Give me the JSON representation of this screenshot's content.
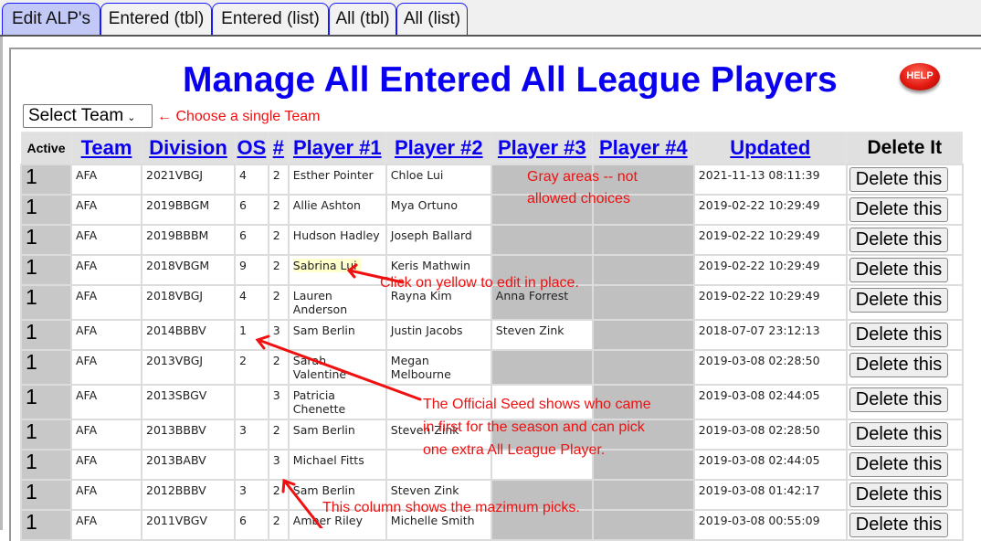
{
  "tabs": [
    {
      "label": "Edit ALP's",
      "active": true
    },
    {
      "label": "Entered (tbl)",
      "active": false
    },
    {
      "label": "Entered (list)",
      "active": false
    },
    {
      "label": "All (tbl)",
      "active": false
    },
    {
      "label": "All (list)",
      "active": false
    }
  ],
  "page": {
    "title": "Manage All Entered All League Players",
    "help_label": "HELP",
    "team_select": {
      "value": "Select Team",
      "chevron": "⌄"
    }
  },
  "annotations": {
    "choose_team": "← Choose a single Team",
    "gray_areas_1": "Gray areas -- not",
    "gray_areas_2": "allowed choices",
    "click_yellow": "Click on yellow to edit in place.",
    "official_seed_1": "The Official Seed shows who came",
    "official_seed_2": "in first for the season and can pick",
    "official_seed_3": "one extra All League Player.",
    "max_picks": "This column shows the mazimum picks.",
    "color": "#f01010"
  },
  "table": {
    "headers": {
      "active": "Active",
      "team": "Team",
      "division": "Division",
      "os": "OS",
      "num": "#",
      "p1": "Player #1",
      "p2": "Player #2",
      "p3": "Player #3",
      "p4": "Player #4",
      "updated": "Updated",
      "delete": "Delete It"
    },
    "delete_label": "Delete this",
    "rows": [
      {
        "active": "1",
        "team": "AFA",
        "division": "2021VBGJ",
        "os": "4",
        "num": "2",
        "p1": "Esther Pointer",
        "p2": "Chloe Lui",
        "p3": "",
        "p4": "",
        "updated": "2021-11-13 08:11:39"
      },
      {
        "active": "1",
        "team": "AFA",
        "division": "2019BBGM",
        "os": "6",
        "num": "2",
        "p1": "Allie Ashton",
        "p2": "Mya Ortuno",
        "p3": "",
        "p4": "",
        "updated": "2019-02-22 10:29:49"
      },
      {
        "active": "1",
        "team": "AFA",
        "division": "2019BBBM",
        "os": "6",
        "num": "2",
        "p1": "Hudson Hadley",
        "p2": "Joseph Ballard",
        "p3": "",
        "p4": "",
        "updated": "2019-02-22 10:29:49"
      },
      {
        "active": "1",
        "team": "AFA",
        "division": "2018VBGM",
        "os": "9",
        "num": "2",
        "p1": "Sabrina Lui",
        "p2": "Keris Mathwin",
        "p3": "",
        "p4": "",
        "updated": "2019-02-22 10:29:49",
        "highlight_p1": true
      },
      {
        "active": "1",
        "team": "AFA",
        "division": "2018VBGJ",
        "os": "4",
        "num": "2",
        "p1": "Lauren Anderson",
        "p2": "Rayna Kim",
        "p3": "Anna Forrest",
        "p4": "",
        "updated": "2019-02-22 10:29:49"
      },
      {
        "active": "1",
        "team": "AFA",
        "division": "2014BBBV",
        "os": "1",
        "num": "3",
        "p1": "Sam Berlin",
        "p2": "Justin Jacobs",
        "p3": "Steven Zink",
        "p4": "",
        "updated": "2018-07-07 23:12:13"
      },
      {
        "active": "1",
        "team": "AFA",
        "division": "2013VBGJ",
        "os": "2",
        "num": "2",
        "p1": "Sarah Valentine",
        "p2": "Megan Melbourne",
        "p3": "",
        "p4": "",
        "updated": "2019-03-08 02:28:50"
      },
      {
        "active": "1",
        "team": "AFA",
        "division": "2013SBGV",
        "os": "",
        "num": "3",
        "p1": "Patricia Chenette",
        "p2": "",
        "p3": "",
        "p4": "",
        "updated": "2019-03-08 02:44:05"
      },
      {
        "active": "1",
        "team": "AFA",
        "division": "2013BBBV",
        "os": "3",
        "num": "2",
        "p1": "Sam Berlin",
        "p2": "Steven Zink",
        "p3": "",
        "p4": "",
        "updated": "2019-03-08 02:28:50"
      },
      {
        "active": "1",
        "team": "AFA",
        "division": "2013BABV",
        "os": "",
        "num": "3",
        "p1": "Michael Fitts",
        "p2": "",
        "p3": "",
        "p4": "",
        "updated": "2019-03-08 02:44:05"
      },
      {
        "active": "1",
        "team": "AFA",
        "division": "2012BBBV",
        "os": "3",
        "num": "2",
        "p1": "Sam Berlin",
        "p2": "Steven Zink",
        "p3": "",
        "p4": "",
        "updated": "2019-03-08 01:42:17"
      },
      {
        "active": "1",
        "team": "AFA",
        "division": "2011VBGV",
        "os": "6",
        "num": "2",
        "p1": "Amber Riley",
        "p2": "Michelle Smith",
        "p3": "",
        "p4": "",
        "updated": "2019-03-08 00:55:09"
      }
    ]
  }
}
